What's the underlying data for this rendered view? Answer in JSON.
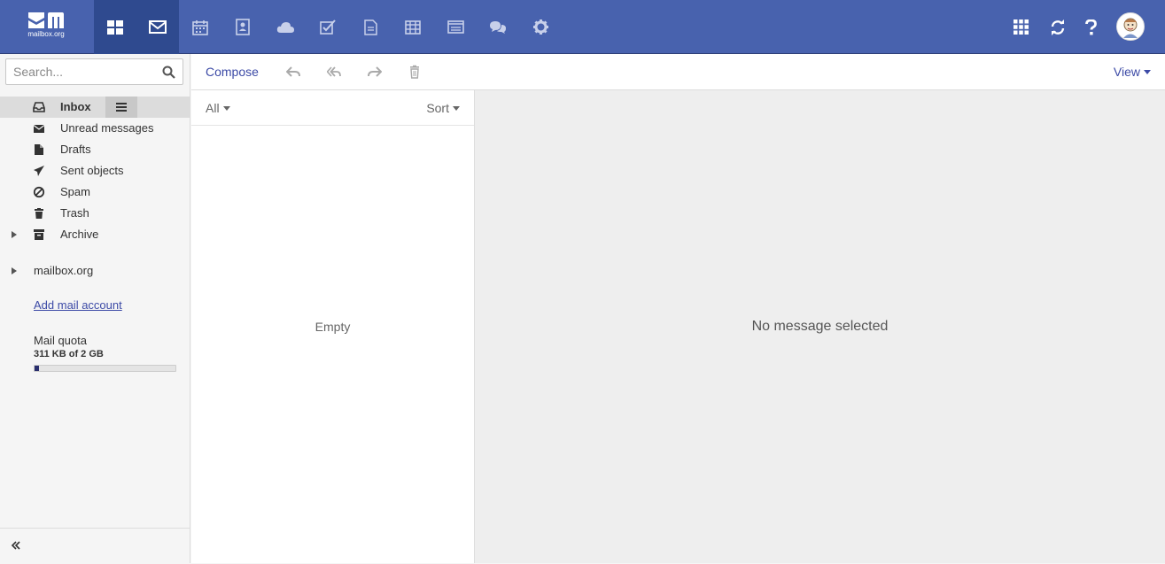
{
  "brand": {
    "name": "mailbox.org",
    "topbar_color": "#4862ae",
    "active_app_color": "#2f4a8f"
  },
  "apps": [
    {
      "name": "portal-icon",
      "active": true
    },
    {
      "name": "mail-icon",
      "active": true
    },
    {
      "name": "calendar-icon",
      "active": false
    },
    {
      "name": "address-book-icon",
      "active": false
    },
    {
      "name": "cloud-drive-icon",
      "active": false
    },
    {
      "name": "tasks-icon",
      "active": false
    },
    {
      "name": "document-icon",
      "active": false
    },
    {
      "name": "spreadsheet-icon",
      "active": false
    },
    {
      "name": "presentation-icon",
      "active": false
    },
    {
      "name": "chat-icon",
      "active": false
    },
    {
      "name": "settings-gear-icon",
      "active": false
    }
  ],
  "topbar_right": [
    "app-launcher-grid-icon",
    "refresh-icon",
    "help-icon",
    "user-avatar"
  ],
  "search": {
    "placeholder": "Search..."
  },
  "folders": [
    {
      "label": "Inbox",
      "icon": "inbox-icon",
      "selected": true
    },
    {
      "label": "Unread messages",
      "icon": "envelope-icon",
      "selected": false
    },
    {
      "label": "Drafts",
      "icon": "draft-file-icon",
      "selected": false
    },
    {
      "label": "Sent objects",
      "icon": "paper-plane-icon",
      "selected": false
    },
    {
      "label": "Spam",
      "icon": "ban-icon",
      "selected": false
    },
    {
      "label": "Trash",
      "icon": "trash-icon",
      "selected": false
    },
    {
      "label": "Archive",
      "icon": "archive-box-icon",
      "selected": false
    }
  ],
  "account": {
    "label": "mailbox.org"
  },
  "add_account_label": "Add mail account",
  "quota": {
    "title": "Mail quota",
    "text": "311 KB of 2 GB",
    "fraction": 0.03
  },
  "toolbar": {
    "compose_label": "Compose",
    "view_label": "View",
    "link_color": "#3c4aa6"
  },
  "list": {
    "filter_label": "All",
    "sort_label": "Sort",
    "empty_label": "Empty"
  },
  "detail": {
    "empty_label": "No message selected"
  }
}
